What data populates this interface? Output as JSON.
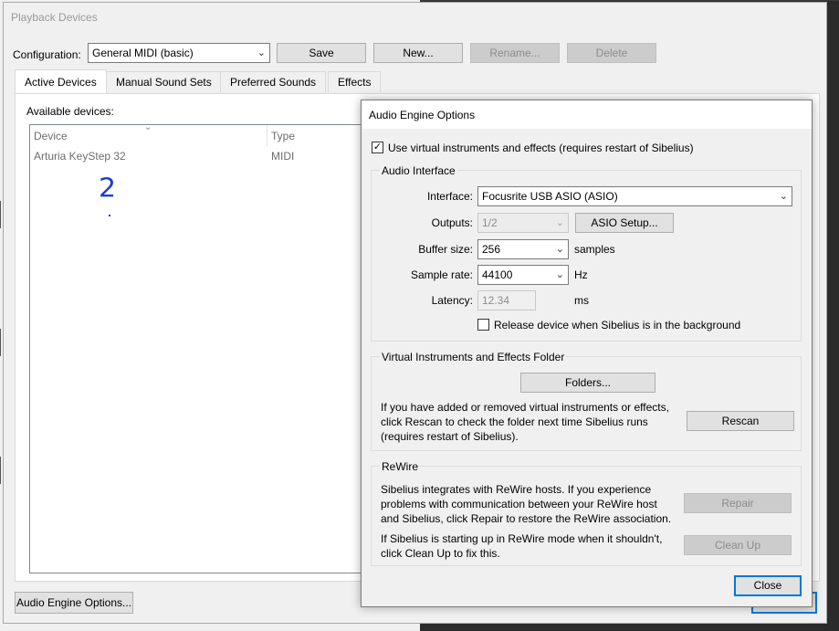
{
  "window": {
    "title": "Playback Devices"
  },
  "configuration": {
    "label": "Configuration:",
    "value": "General MIDI (basic)",
    "buttons": {
      "save": "Save",
      "new": "New...",
      "rename": "Rename...",
      "delete": "Delete"
    }
  },
  "tabs": [
    "Active Devices",
    "Manual Sound Sets",
    "Preferred Sounds",
    "Effects"
  ],
  "active_devices": {
    "available_label": "Available devices:",
    "columns": [
      "Device",
      "Type"
    ],
    "rows": [
      {
        "device": "Arturia KeyStep 32",
        "type": "MIDI"
      }
    ],
    "annotation": "2"
  },
  "audio_engine_button": "Audio Engine Options...",
  "aeo": {
    "title": "Audio Engine Options",
    "use_virtual": {
      "checked": true,
      "label": "Use virtual instruments and effects (requires restart of Sibelius)"
    },
    "audio_interface": {
      "group_label": "Audio Interface",
      "interface_label": "Interface:",
      "interface_value": "Focusrite USB ASIO (ASIO)",
      "outputs_label": "Outputs:",
      "outputs_value": "1/2",
      "asio_setup": "ASIO Setup...",
      "buffer_label": "Buffer size:",
      "buffer_value": "256",
      "buffer_unit": "samples",
      "rate_label": "Sample rate:",
      "rate_value": "44100",
      "rate_unit": "Hz",
      "latency_label": "Latency:",
      "latency_value": "12.34",
      "latency_unit": "ms",
      "release": {
        "checked": false,
        "label": "Release device when Sibelius is in the background"
      }
    },
    "vi_folder": {
      "group_label": "Virtual Instruments and Effects Folder",
      "folders_button": "Folders...",
      "text_lines": [
        "If you have added or removed virtual instruments or effects,",
        "click Rescan to check the folder next time Sibelius runs",
        "(requires restart of Sibelius)."
      ],
      "rescan_button": "Rescan"
    },
    "rewire": {
      "group_label": "ReWire",
      "text1_lines": [
        "Sibelius integrates with ReWire hosts. If you experience",
        "problems with communication between your ReWire host",
        "and Sibelius, click Repair to restore the ReWire association."
      ],
      "repair_button": "Repair",
      "text2_lines": [
        "If Sibelius is starting up in ReWire mode when it shouldn't,",
        "click Clean Up to fix this."
      ],
      "cleanup_button": "Clean Up"
    },
    "close_button": "Close"
  }
}
